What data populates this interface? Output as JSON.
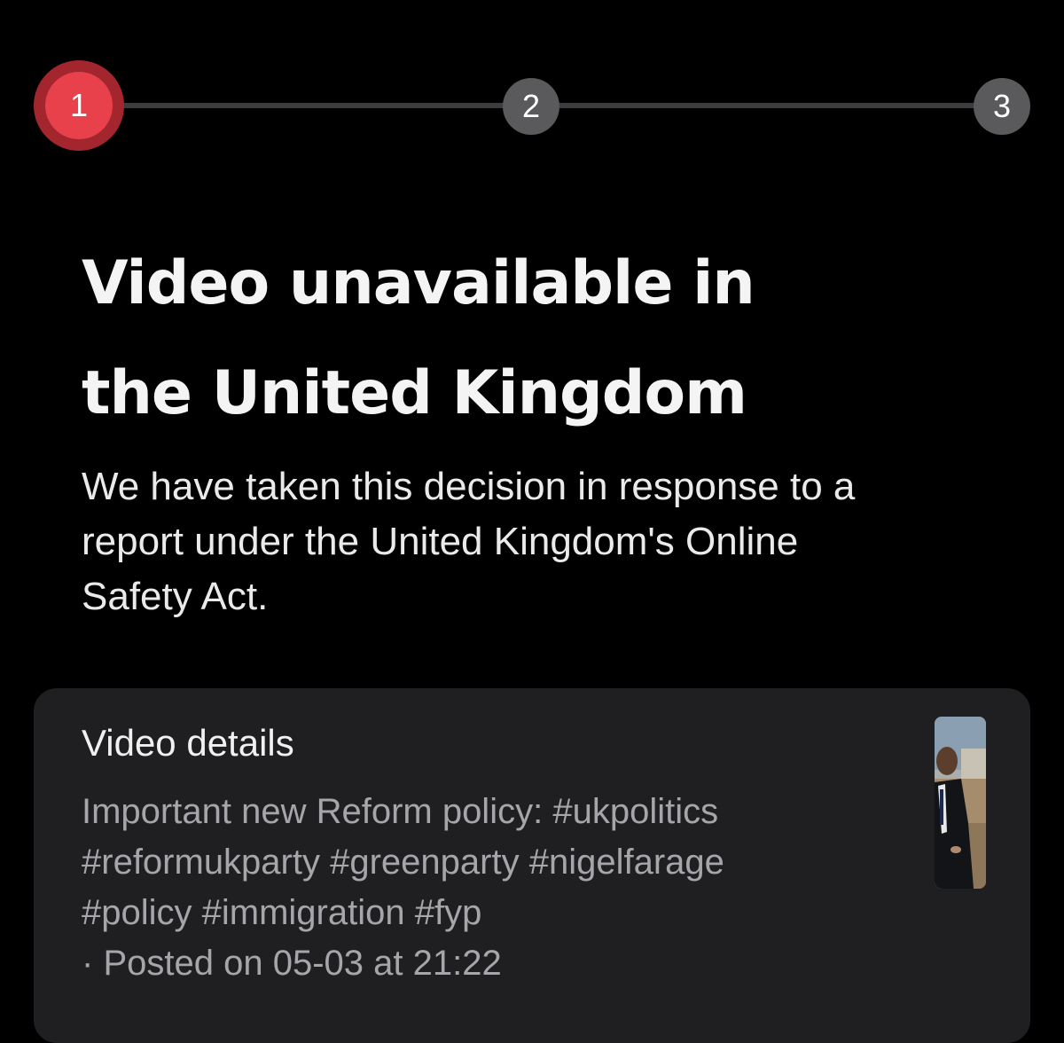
{
  "stepper": {
    "steps": [
      {
        "label": "1",
        "state": "active"
      },
      {
        "label": "2",
        "state": "inactive"
      },
      {
        "label": "3",
        "state": "inactive"
      }
    ],
    "active_color": "#e8414c",
    "inactive_color": "#5a5a5c"
  },
  "notice": {
    "title_line1": "Video unavailable in",
    "title_line2": "the United Kingdom",
    "description_line1": "We have taken this decision in response to a",
    "description_line2": "report under the United Kingdom's Online",
    "description_line3": "Safety Act."
  },
  "video_details": {
    "heading": "Video details",
    "caption_text": "Important new Reform policy:",
    "hashtags": [
      "#ukpolitics",
      "#reformukparty",
      "#greenparty",
      "#nigelfarage",
      "#policy",
      "#immigration",
      "#fyp"
    ],
    "posted_prefix": "·",
    "posted_text": "Posted on 05-03 at 21:22",
    "thumbnail_icon": "video-thumbnail"
  },
  "colors": {
    "background": "#000000",
    "card_background": "#1f1f21",
    "text_primary": "#f4f4f4",
    "text_secondary": "#a6a6aa"
  }
}
